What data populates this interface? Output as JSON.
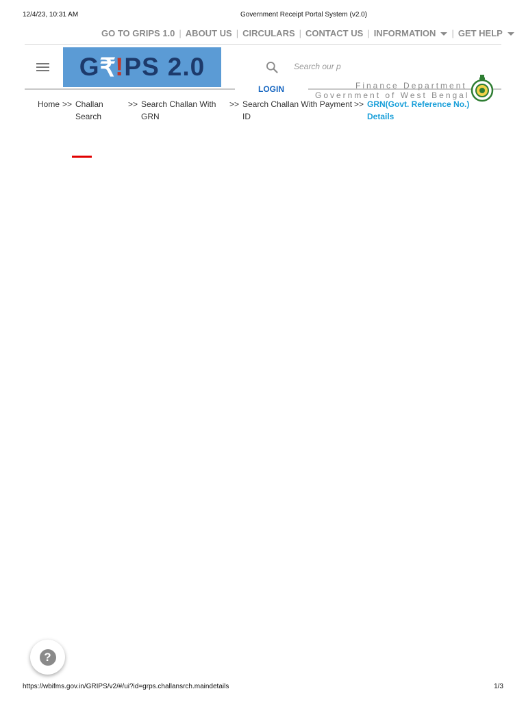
{
  "print": {
    "datetime": "12/4/23, 10:31 AM",
    "title": "Government Receipt Portal System (v2.0)",
    "url": "https://wbifms.gov.in/GRIPS/v2/#/ui?id=grps.challansrch.maindetails",
    "page": "1/3"
  },
  "topnav": {
    "grips1": "GO TO GRIPS 1.0",
    "about": "ABOUT US",
    "circulars": "CIRCULARS",
    "contact": "CONTACT US",
    "information": "INFORMATION",
    "help": "GET HELP",
    "separator": "|"
  },
  "header": {
    "logo": {
      "grips": "G",
      "rupee": "₹",
      "bang": "!",
      "ips": "PS",
      "version": "2.0"
    },
    "search_placeholder": "Search our p",
    "login": "LOGIN",
    "dept_line1": "Finance Department",
    "dept_line2": "Government of West Bengal"
  },
  "breadcrumb": {
    "separator": ">>",
    "items": [
      {
        "label": "Home"
      },
      {
        "label": "Challan Search"
      },
      {
        "label": "Search Challan With GRN"
      },
      {
        "label": "Search Challan With Payment ID"
      },
      {
        "label": "GRN(Govt. Reference No.) Details"
      }
    ]
  },
  "colors": {
    "accent": "#1a9fd9",
    "login": "#1565c0",
    "logo_bg": "#5b9bd5",
    "red_bar": "#e10000"
  },
  "icons": [
    "menu-icon",
    "search-icon",
    "wb-emblem-icon",
    "help-icon",
    "caret-down-icon"
  ]
}
